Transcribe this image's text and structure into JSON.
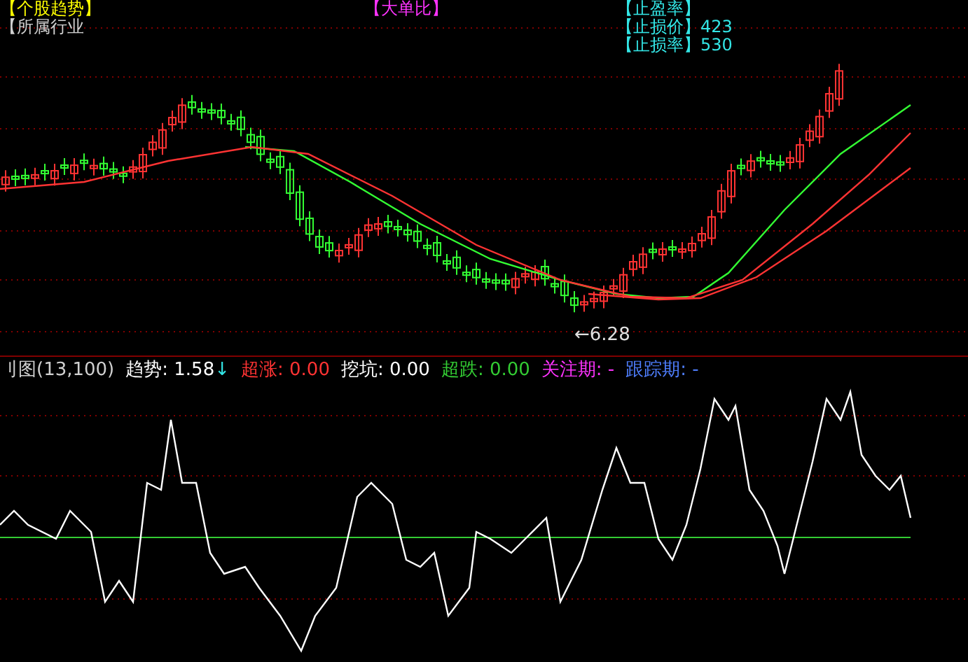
{
  "header_groups": [
    {
      "labels": [
        {
          "text": "【个股趋势】",
          "color": "#ffff00"
        },
        {
          "text": "【所属行业",
          "color": "#d0d0d0"
        }
      ]
    },
    {
      "labels": [
        {
          "text": "【大单比】",
          "color": "#ff33ff"
        }
      ]
    },
    {
      "labels": [
        {
          "text": "【止盈率】",
          "color": "#33e6e6"
        },
        {
          "text": "【止损价】423",
          "color": "#33e6e6"
        },
        {
          "text": "【止损率】530",
          "color": "#33e6e6"
        }
      ]
    }
  ],
  "price_label": "←6.28",
  "indicator_header": {
    "title": "刂图(13,100)",
    "items": [
      {
        "label": "趋势:",
        "value": "1.58",
        "arrow": "↓",
        "color": "#ffffff"
      },
      {
        "label": "超涨:",
        "value": "0.00",
        "color": "#ff3333"
      },
      {
        "label": "挖坑:",
        "value": "0.00",
        "color": "#ffffff"
      },
      {
        "label": "超跌:",
        "value": "0.00",
        "color": "#33cc33"
      },
      {
        "label": "关注期:",
        "value": "-",
        "color": "#ff33ff"
      },
      {
        "label": "跟踪期:",
        "value": "-",
        "color": "#4f7fff"
      }
    ]
  }
}
